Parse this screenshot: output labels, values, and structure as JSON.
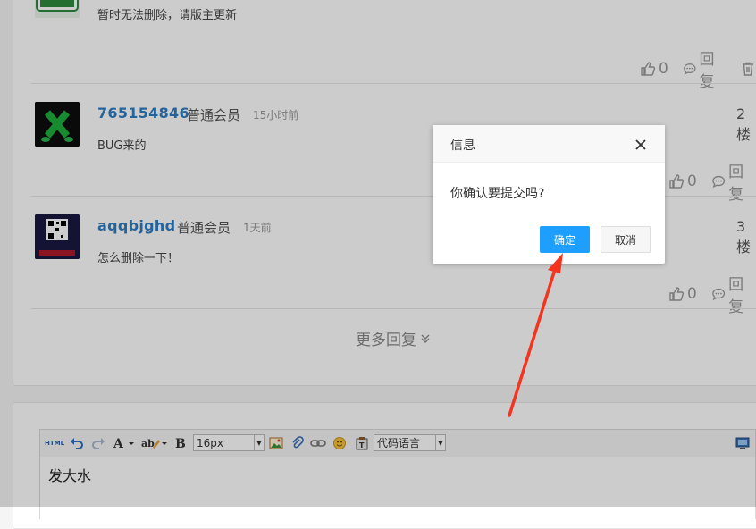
{
  "replies": [
    {
      "text": "暂时无法删除，请版主更新",
      "likes": "0",
      "reply_label": "回复"
    },
    {
      "username": "765154846",
      "role": "普通会员",
      "time": "15小时前",
      "text": "BUG来的",
      "floor": "2楼",
      "likes": "0",
      "reply_label": "回复"
    },
    {
      "username": "aqqbjghd",
      "role": "普通会员",
      "time": "1天前",
      "text": "怎么删除一下！",
      "floor": "3楼",
      "likes": "0",
      "reply_label": "回复"
    }
  ],
  "more_replies": "更多回复",
  "editor": {
    "html_label": "HTML",
    "font_size": "16px",
    "code_lang": "代码语言",
    "content": "发大水"
  },
  "dialog": {
    "title": "信息",
    "message": "你确认要提交吗?",
    "ok": "确定",
    "cancel": "取消"
  },
  "colors": {
    "link_blue": "#2e7ec3",
    "ok_button": "#1e9fff",
    "arrow_red": "#f5341f"
  }
}
